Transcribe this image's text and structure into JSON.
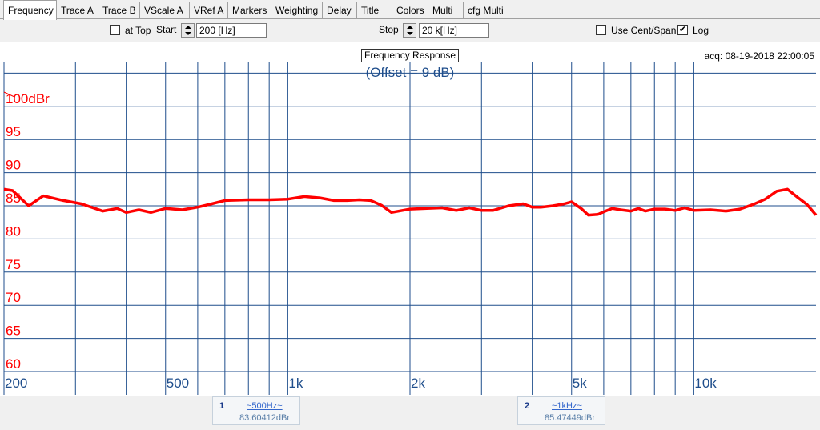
{
  "tabs": [
    {
      "label": "Frequency",
      "active": true
    },
    {
      "label": "Trace A"
    },
    {
      "label": "Trace B"
    },
    {
      "label": "VScale A"
    },
    {
      "label": "VRef A"
    },
    {
      "label": "Markers"
    },
    {
      "label": "Weighting"
    },
    {
      "label": "Delay"
    },
    {
      "label": "Title"
    },
    {
      "label": "Colors"
    },
    {
      "label": "Multi"
    },
    {
      "label": "cfg Multi"
    }
  ],
  "controls": {
    "at_top_label": "at Top",
    "at_top_checked": false,
    "start_label": "Start",
    "start_value": "200 [Hz]",
    "stop_label": "Stop",
    "stop_value": "20 k[Hz]",
    "use_cent_span_label": "Use Cent/Span",
    "use_cent_span_checked": false,
    "log_label": "Log",
    "log_checked": true,
    "check_mark": "✔"
  },
  "graph": {
    "title": "Frequency Response",
    "offset_text": "(Offset = 9 dB)",
    "acq_text": "acq: 08-19-2018 22:00:05",
    "background_color": "#ffffff",
    "grid_color": "#1f4e8c",
    "trace_color": "#ff0000"
  },
  "chart_data": {
    "type": "line",
    "title": "Frequency Response",
    "subtitle": "(Offset = 9 dB)",
    "xlabel": "",
    "ylabel": "",
    "x_scale": "log",
    "xlim": [
      200,
      20000
    ],
    "ylim": [
      60,
      105
    ],
    "x_ticks": [
      200,
      500,
      1000,
      2000,
      5000,
      10000
    ],
    "x_tick_labels": [
      "200",
      "500",
      "1k",
      "2k",
      "5k",
      "10k"
    ],
    "y_ticks": [
      60,
      65,
      70,
      75,
      80,
      85,
      90,
      95,
      100
    ],
    "y_tick_labels": [
      "60",
      "65",
      "70",
      "75",
      "80",
      "85",
      "90",
      "95",
      "100dBr"
    ],
    "grid": true,
    "series": [
      {
        "x": [
          200,
          210,
          230,
          250,
          280,
          310,
          350,
          380,
          400,
          430,
          460,
          500,
          550,
          600,
          650,
          700,
          800,
          900,
          1000,
          1100,
          1200,
          1300,
          1400,
          1500,
          1600,
          1700,
          1800,
          2000,
          2200,
          2400,
          2600,
          2800,
          3000,
          3200,
          3500,
          3800,
          4000,
          4200,
          4500,
          4800,
          5000,
          5300,
          5500,
          5800,
          6000,
          6300,
          6600,
          7000,
          7300,
          7600,
          8000,
          8500,
          9000,
          9500,
          10000,
          11000,
          12000,
          13000,
          14000,
          15000,
          16000,
          17000,
          18000,
          19000,
          20000
        ],
        "y": [
          87.5,
          87.3,
          85.0,
          86.5,
          85.8,
          85.3,
          84.2,
          84.6,
          84.0,
          84.4,
          84.0,
          84.6,
          84.4,
          84.8,
          85.3,
          85.8,
          85.9,
          85.9,
          86.0,
          86.4,
          86.2,
          85.8,
          85.8,
          85.9,
          85.8,
          85.1,
          84.0,
          84.5,
          84.6,
          84.7,
          84.3,
          84.7,
          84.3,
          84.3,
          85.0,
          85.3,
          84.8,
          84.8,
          85.0,
          85.3,
          85.6,
          84.5,
          83.6,
          83.7,
          84.1,
          84.6,
          84.4,
          84.2,
          84.6,
          84.2,
          84.5,
          84.5,
          84.3,
          84.7,
          84.3,
          84.4,
          84.2,
          84.5,
          85.2,
          86.0,
          87.2,
          87.5,
          86.3,
          85.2,
          83.6
        ]
      }
    ],
    "markers": [
      {
        "number": "1",
        "frequency": "~500Hz~",
        "value": "83.60412dBr"
      },
      {
        "number": "2",
        "frequency": "~1kHz~",
        "value": "85.47449dBr"
      }
    ]
  }
}
